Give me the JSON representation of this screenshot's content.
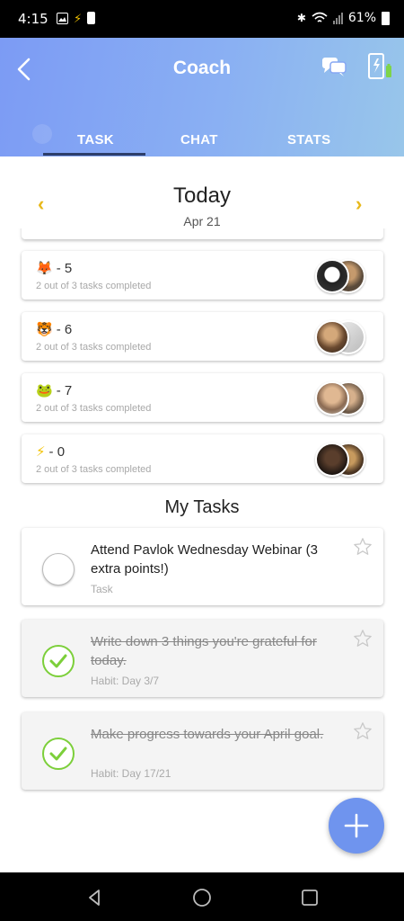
{
  "status_bar": {
    "time": "4:15",
    "battery": "61%"
  },
  "header": {
    "title": "Coach",
    "tabs": [
      {
        "label": "TASK",
        "active": true
      },
      {
        "label": "CHAT",
        "active": false
      },
      {
        "label": "STATS",
        "active": false
      }
    ],
    "gradient_start": "#7c9bf4",
    "gradient_end": "#98c6ea"
  },
  "date_nav": {
    "title": "Today",
    "date": "Apr 21"
  },
  "teams": [
    {
      "emoji": "🦊",
      "name": "- 5",
      "progress": "2 out of 3 tasks completed"
    },
    {
      "emoji": "🐯",
      "name": "- 6",
      "progress": "2 out of 3 tasks completed"
    },
    {
      "emoji": "🐸",
      "name": "- 7",
      "progress": "2 out of 3 tasks completed"
    },
    {
      "emoji": "⚡",
      "name": "- 0",
      "progress": "2 out of 3 tasks completed"
    }
  ],
  "my_tasks": {
    "title": "My Tasks",
    "items": [
      {
        "title": "Attend Pavlok Wednesday Webinar (3 extra points!)",
        "meta": "Task",
        "completed": false
      },
      {
        "title": "Write down 3 things you're grateful for today.",
        "meta": "Habit: Day 3/7",
        "completed": true
      },
      {
        "title": "Make progress towards your April goal.",
        "meta": "Habit: Day 17/21",
        "completed": true
      }
    ]
  },
  "colors": {
    "accent": "#6f94ee",
    "arrow": "#e8b81a",
    "check": "#7ccf3a"
  }
}
